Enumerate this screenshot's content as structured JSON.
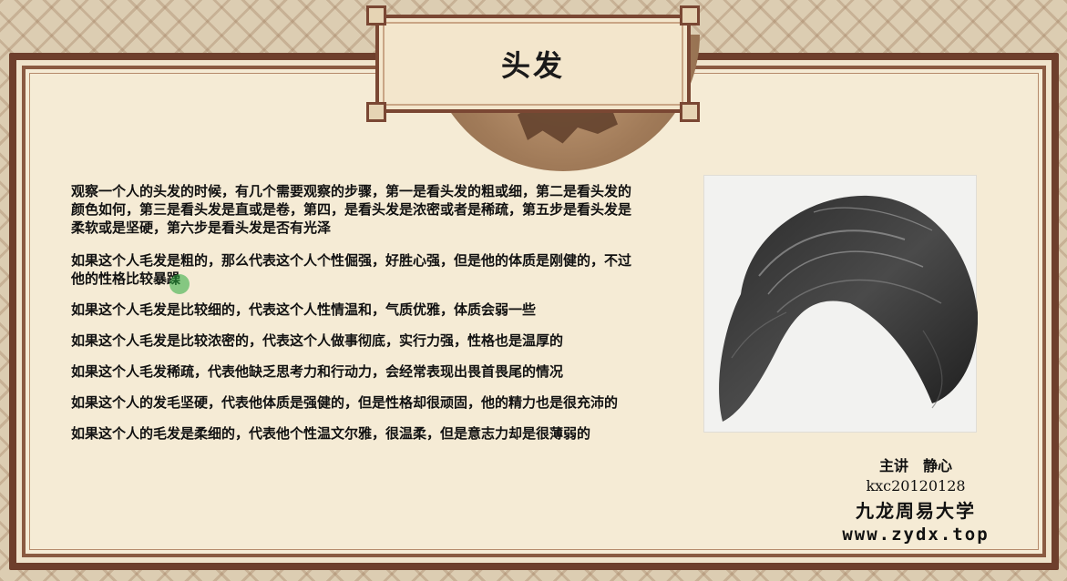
{
  "slide": {
    "title": "头发",
    "paragraphs": [
      "观察一个人的头发的时候，有几个需要观察的步骤，第一是看头发的粗或细，第二是看头发的颜色如何，第三是看头发是直或是卷，第四，是看头发是浓密或者是稀疏，第五步是看头发是柔软或是坚硬，第六步是看头发是否有光泽",
      "如果这个人毛发是粗的，那么代表这个人个性倔强，好胜心强，但是他的体质是刚健的，不过他的性格比较暴躁",
      "如果这个人毛发是比较细的，代表这个人性情温和，气质优雅，体质会弱一些",
      "如果这个人毛发是比较浓密的，代表这个人做事彻底，实行力强，性格也是温厚的",
      "如果这个人毛发稀疏，代表他缺乏思考力和行动力，会经常表现出畏首畏尾的情况",
      "如果这个人的发毛坚硬，代表他体质是强健的，但是性格却很顽固，他的精力也是很充沛的",
      "如果这个人的毛发是柔细的，代表他个性温文尔雅，很温柔，但是意志力却是很薄弱的"
    ],
    "credit": {
      "speaker": "主讲　静心",
      "id": "kxc20120128",
      "org": "九龙周易大学",
      "url": "www.zydx.top"
    }
  },
  "colors": {
    "frame": "#6e3f2c",
    "paper": "#f5ebd5",
    "pointer": "#28aa3c"
  }
}
